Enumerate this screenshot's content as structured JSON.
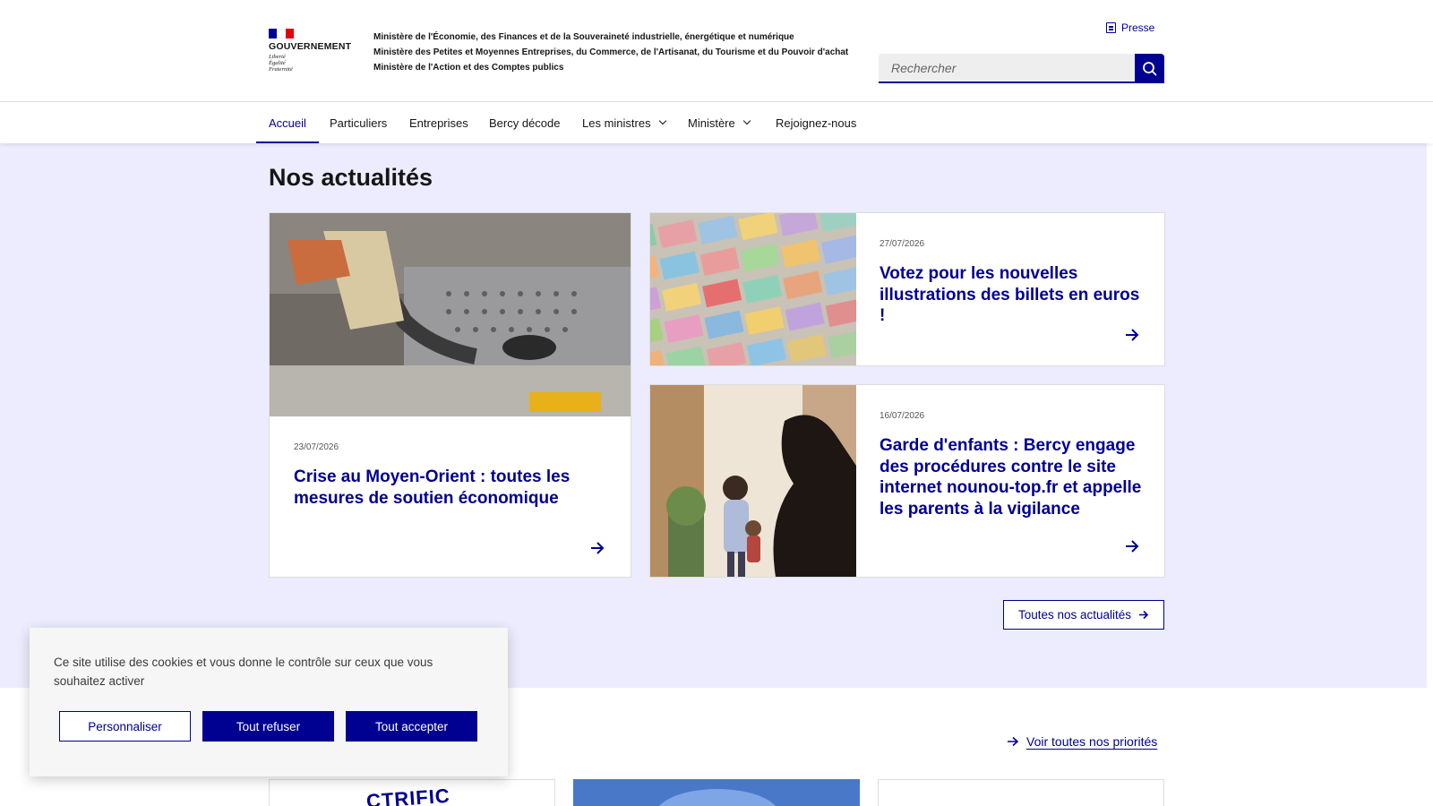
{
  "header": {
    "gov_name": "GOUVERNEMENT",
    "motto": [
      "Liberté",
      "Égalité",
      "Fraternité"
    ],
    "ministries": [
      "Ministère de l'Économie, des Finances et de la Souveraineté industrielle, énergétique et numérique",
      "Ministère des Petites et Moyennes Entreprises, du Commerce, de l'Artisanat, du Tourisme et du Pouvoir d'achat",
      "Ministère de l'Action et des Comptes publics"
    ],
    "presse_label": "Presse",
    "search_placeholder": "Rechercher"
  },
  "nav": {
    "items": [
      {
        "label": "Accueil"
      },
      {
        "label": "Particuliers"
      },
      {
        "label": "Entreprises"
      },
      {
        "label": "Bercy décode"
      },
      {
        "label": "Les ministres"
      },
      {
        "label": "Ministère"
      },
      {
        "label": "Rejoignez-nous"
      }
    ]
  },
  "news": {
    "title": "Nos actualités",
    "cards": [
      {
        "date": "23/07/2026",
        "title": "Crise au Moyen-Orient : toutes les mesures de soutien économique"
      },
      {
        "date": "27/07/2026",
        "title": "Votez pour les nouvelles illustrations des billets en euros !"
      },
      {
        "date": "16/07/2026",
        "title": "Garde d'enfants : Bercy engage des procédures contre le site internet nounou-top.fr et appelle les parents à la vigilance"
      }
    ],
    "all_label": "Toutes nos actualités"
  },
  "priorities": {
    "link_label": "Voir toutes nos priorités",
    "card1_text": "CTRIFIC"
  },
  "cookie": {
    "text": "Ce site utilise des cookies et vous donne le contrôle sur ceux que vous souhaitez activer",
    "personnaliser": "Personnaliser",
    "refuser": "Tout refuser",
    "accepter": "Tout accepter"
  },
  "colors": {
    "primary": "#000091",
    "flag_blue": "#000091",
    "flag_red": "#e1000f",
    "section_bg": "#ececfe"
  }
}
